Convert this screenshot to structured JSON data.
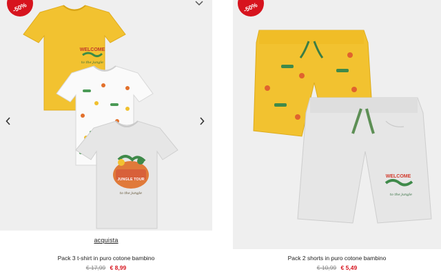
{
  "products": [
    {
      "badge": "-50%",
      "buy_label": "acquista",
      "title": "Pack 3 t-shirt in puro cotone bambino",
      "old_price": "€ 17,99",
      "new_price": "€ 8,99",
      "print_text": "WELCOME",
      "print_script": "to the jungle",
      "print_text_2": "JUNGLE TOUR"
    },
    {
      "badge": "-50%",
      "title": "Pack 2 shorts in puro cotone bambino",
      "old_price": "€ 10,99",
      "new_price": "€ 5,49",
      "print_text": "WELCOME",
      "print_script": "to the jungle"
    }
  ],
  "colors": {
    "sale_red": "#d7141e",
    "bg_gray": "#efefef",
    "mustard": "#f2c230",
    "heather": "#e6e6e6"
  },
  "icons": {
    "prev": "chevron-left-icon",
    "next": "chevron-right-icon",
    "wishlist": "heart-icon"
  }
}
